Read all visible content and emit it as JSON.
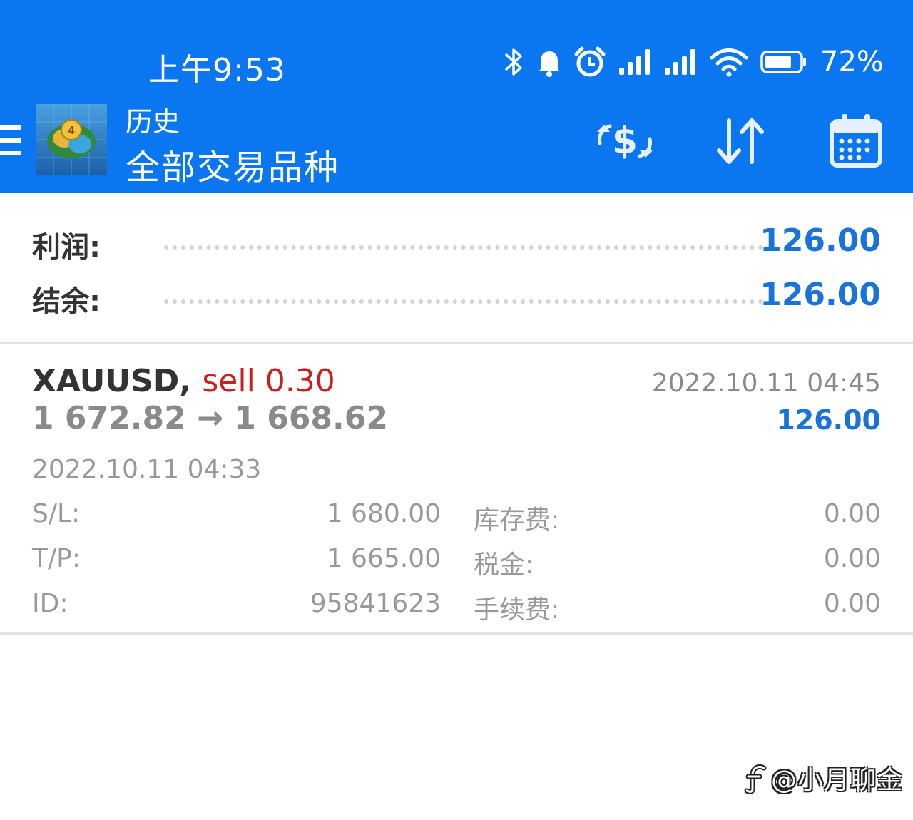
{
  "colors": {
    "header_bg": "#0a76f0",
    "accent_value": "#1a73d9",
    "sell": "#cc1f1f",
    "muted": "#999999"
  },
  "status_bar": {
    "time": "上午9:53",
    "icons": [
      "bluetooth-icon",
      "bell-icon",
      "alarm-icon",
      "signal-icon",
      "signal-icon",
      "wifi-icon",
      "battery-icon"
    ],
    "battery_percent": "72%"
  },
  "header": {
    "title": "历史",
    "subtitle": "全部交易品种",
    "toolbar": [
      "currency-exchange-icon",
      "sort-icon",
      "calendar-icon"
    ]
  },
  "summary": {
    "profit_label": "利润:",
    "profit_value": "126.00",
    "balance_label": "结余:",
    "balance_value": "126.00"
  },
  "deal": {
    "symbol": "XAUUSD,",
    "side_volume": "sell 0.30",
    "close_time": "2022.10.11 04:45",
    "open_price": "1 672.82",
    "arrow": "→",
    "close_price": "1 668.62",
    "profit": "126.00",
    "open_time": "2022.10.11 04:33",
    "details": [
      {
        "label": "S/L:",
        "value": "1 680.00",
        "label2": "库存费:",
        "value2": "0.00"
      },
      {
        "label": "T/P:",
        "value": "1 665.00",
        "label2": "税金:",
        "value2": "0.00"
      },
      {
        "label": "ID:",
        "value": "95841623",
        "label2": "手续费:",
        "value2": "0.00"
      }
    ]
  },
  "watermark": {
    "text": "@小月聊金"
  }
}
